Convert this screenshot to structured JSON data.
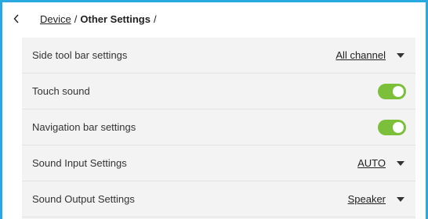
{
  "breadcrumb": {
    "root": "Device",
    "separator1": "/",
    "current": "Other Settings",
    "separator2": "/"
  },
  "icons": {
    "back": "chevron-left-icon",
    "dropdown": "caret-down-icon",
    "toggle": "toggle-switch"
  },
  "colors": {
    "accent_border": "#29a9df",
    "toggle_on": "#7cbf3a",
    "panel_bg": "#f3f3f3"
  },
  "settings": {
    "side_tool_bar": {
      "label": "Side tool bar settings",
      "value": "All channel"
    },
    "touch_sound": {
      "label": "Touch sound",
      "enabled": true
    },
    "navigation_bar": {
      "label": "Navigation bar settings",
      "enabled": true
    },
    "sound_input": {
      "label": "Sound Input Settings",
      "value": "AUTO"
    },
    "sound_output": {
      "label": "Sound Output Settings",
      "value": "Speaker"
    }
  }
}
